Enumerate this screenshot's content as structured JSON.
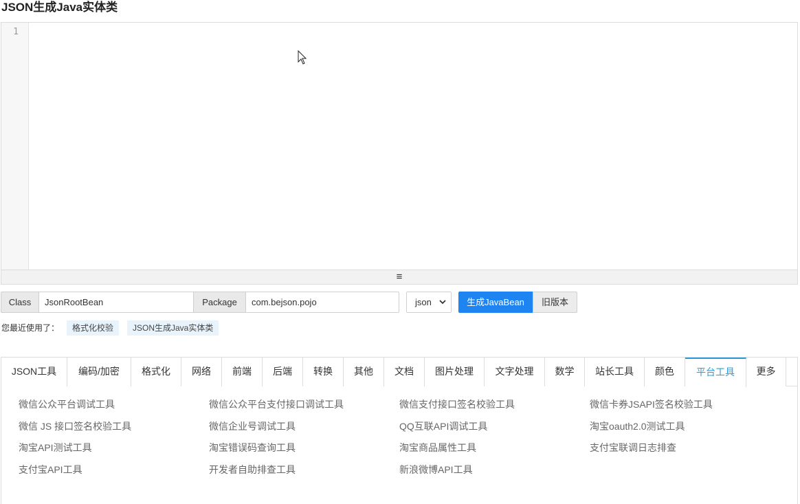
{
  "page": {
    "title": "JSON生成Java实体类"
  },
  "editor": {
    "line_number": "1",
    "resize_icon": "≡"
  },
  "form": {
    "class_label": "Class",
    "class_value": "JsonRootBean",
    "package_label": "Package",
    "package_value": "com.bejson.pojo",
    "format_selected": "json",
    "generate_label": "生成JavaBean",
    "old_version_label": "旧版本"
  },
  "recent": {
    "label": "您最近使用了：",
    "items": [
      "格式化校验",
      "JSON生成Java实体类"
    ]
  },
  "tabs": [
    "JSON工具",
    "编码/加密",
    "格式化",
    "网络",
    "前端",
    "后端",
    "转换",
    "其他",
    "文档",
    "图片处理",
    "文字处理",
    "数学",
    "站长工具",
    "颜色",
    "平台工具",
    "更多"
  ],
  "active_tab": "平台工具",
  "tools": [
    "微信公众平台调试工具",
    "微信公众平台支付接口调试工具",
    "微信支付接口签名校验工具",
    "微信卡券JSAPI签名校验工具",
    "微信 JS 接口签名校验工具",
    "微信企业号调试工具",
    "QQ互联API调试工具",
    "淘宝oauth2.0测试工具",
    "淘宝API测试工具",
    "淘宝错误码查询工具",
    "淘宝商品属性工具",
    "支付宝联调日志排查",
    "支付宝API工具",
    "开发者自助排查工具",
    "新浪微博API工具"
  ],
  "colors": {
    "primary": "#1e84f2",
    "active_tab": "#2f9bd6",
    "tag_bg": "#e8f3fb"
  }
}
